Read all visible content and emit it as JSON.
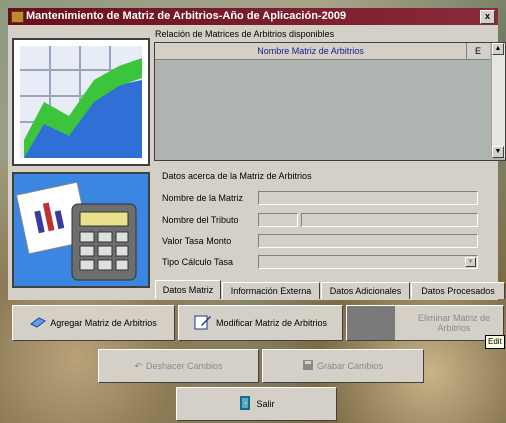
{
  "window": {
    "title": "Mantenimiento de Matriz de Arbitrios-Año de Aplicación-2009",
    "close_label": "x"
  },
  "list_section": {
    "label": "Relación de Matrices de Arbitrios disponibles",
    "columns": [
      "Nombre Matriz de Arbitrios",
      "E"
    ],
    "rows": []
  },
  "details": {
    "section_label": "Datos acerca de la Matriz de Arbitrios",
    "fields": {
      "nombre_matriz": {
        "label": "Nombre de la Matriz",
        "value": ""
      },
      "nombre_tributo": {
        "label": "Nombre del Tributo",
        "code": "",
        "value": ""
      },
      "valor_tasa": {
        "label": "Valor Tasa Monto",
        "value": ""
      },
      "tipo_calculo": {
        "label": "Tipo Cálculo Tasa",
        "value": ""
      }
    }
  },
  "tabs": [
    "Datos Matriz",
    "Información Externa",
    "Datos Adicionales",
    "Datos Procesados"
  ],
  "active_tab": "Datos Matriz",
  "buttons": {
    "agregar": "Agregar Matriz de Arbitrios",
    "modificar": "Modificar Matriz de Arbitrios",
    "eliminar": "Eliminar Matriz de Arbitrios",
    "deshacer": "Deshacer Cambios",
    "grabar": "Grabar Cambios",
    "salir": "Salir"
  },
  "tooltip": "Edit",
  "icons": [
    "app-icon",
    "chart-icon",
    "calculator-icon",
    "add-icon",
    "edit-icon",
    "undo-icon",
    "save-icon",
    "exit-door-icon"
  ]
}
